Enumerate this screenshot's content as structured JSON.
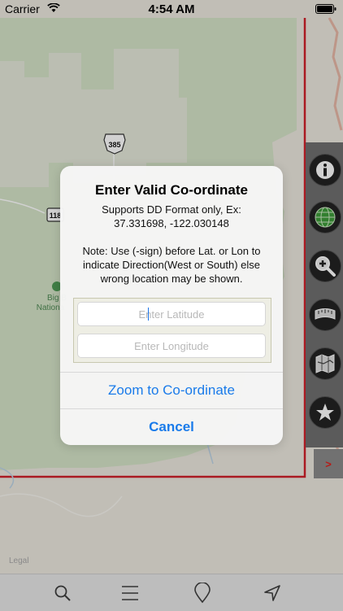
{
  "status_bar": {
    "carrier": "Carrier",
    "time": "4:54 AM"
  },
  "map": {
    "route_shield_1": "385",
    "route_shield_2": "118",
    "park_label_line1": "Big B",
    "park_label_line2": "Nationa",
    "legal": "Legal",
    "colors": {
      "park": "#d5e3c7",
      "land": "#ece8df",
      "boundary": "#d0202a",
      "road": "#e7b7a6"
    }
  },
  "dialog": {
    "title": "Enter Valid Co-ordinate",
    "message_line1": "Supports DD Format only, Ex:",
    "message_line2": "37.331698, -122.030148",
    "note_line1": "Note: Use (-sign) before Lat. or Lon to",
    "note_line2": "indicate Direction(West or South) else",
    "note_line3": "wrong location may be shown.",
    "latitude_placeholder": "Enter Latitude",
    "longitude_placeholder": "Enter Longitude",
    "zoom_label": "Zoom to Co-ordinate",
    "cancel_label": "Cancel",
    "accent": "#1a7bea"
  },
  "right_toolbar": {
    "buttons": [
      "info-icon",
      "globe-icon",
      "zoom-in-icon",
      "ruler-icon",
      "map-layers-icon",
      "star-icon"
    ],
    "expand_label": ">"
  },
  "bottom_toolbar": {
    "buttons": [
      "search-icon",
      "menu-icon",
      "pin-icon",
      "location-arrow-icon"
    ]
  }
}
